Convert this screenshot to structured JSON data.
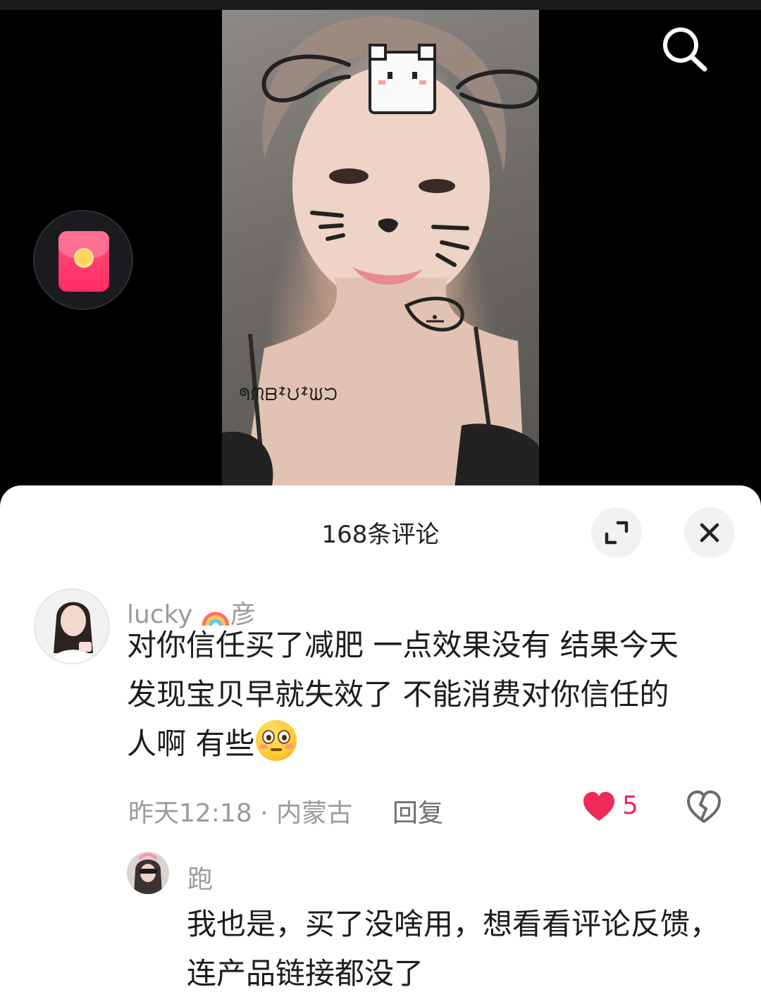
{
  "video": {
    "sticker_text": "ᖗᙏᗷᙇᙀᙇᙎᙂ"
  },
  "comments_panel": {
    "title": "168条评论"
  },
  "comments": [
    {
      "username_prefix": "lucky ",
      "username_suffix": "彦",
      "name_emoji": "rainbow-icon",
      "text_line1": "对你信任买了减肥 一点效果没有 结果今天",
      "text_line2": "发现宝贝早就失效了 不能消费对你信任的",
      "text_line3": "人啊 有些",
      "text_emoji": "flushed-face-emoji",
      "time": "昨天12:18",
      "separator": " · ",
      "location": "内蒙古",
      "reply_label": "回复",
      "likes": "5"
    },
    {
      "username": "跑",
      "text_line1": "我也是，买了没啥用，想看看评论反馈，",
      "text_line2": "连产品链接都没了"
    }
  ],
  "colors": {
    "like": "#ee2a5a",
    "muted_text": "#9a9aa0",
    "sheet_bg": "#ffffff"
  }
}
